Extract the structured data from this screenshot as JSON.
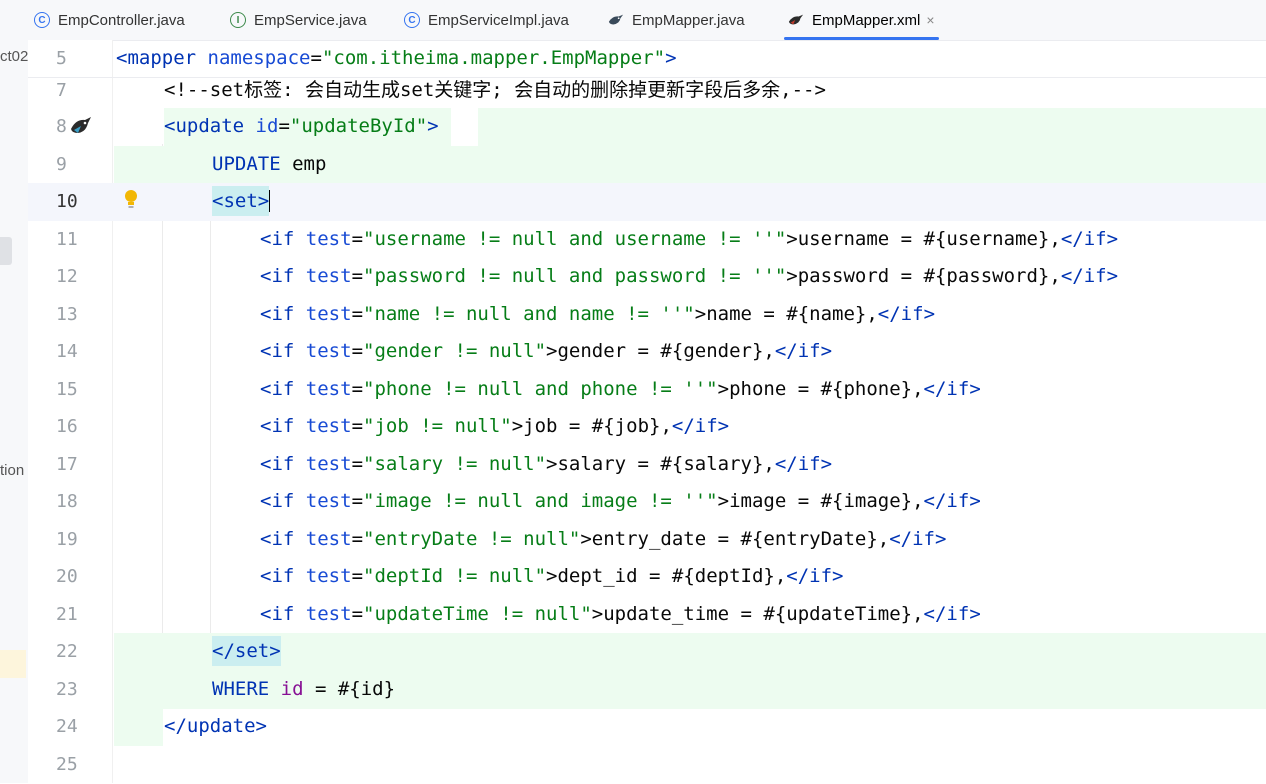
{
  "left_panel": {
    "fragment_top": "ct02",
    "fragment_mid": "tion"
  },
  "tabs": [
    {
      "label": "EmpController.java",
      "icon": "java-class-icon",
      "icon_glyph": "C"
    },
    {
      "label": "EmpService.java",
      "icon": "java-interface-icon",
      "icon_glyph": "I"
    },
    {
      "label": "EmpServiceImpl.java",
      "icon": "java-class-icon",
      "icon_glyph": "C"
    },
    {
      "label": "EmpMapper.java",
      "icon": "mybatis-bird-icon"
    },
    {
      "label": "EmpMapper.xml",
      "icon": "mybatis-bird-icon",
      "active": true,
      "close": "×"
    }
  ],
  "editor": {
    "line_numbers": [
      "5",
      "7",
      "8",
      "9",
      "10",
      "11",
      "12",
      "13",
      "14",
      "15",
      "16",
      "17",
      "18",
      "19",
      "20",
      "21",
      "22",
      "23",
      "24",
      "25"
    ],
    "current_line": "10",
    "colors": {
      "tag": "#0033b3",
      "string": "#067d17",
      "comment": "#8c8c8c",
      "added_bg": "#edfcf0",
      "tab_accent": "#3574f0"
    },
    "text": {
      "l5_open": "<",
      "l5_tag": "mapper",
      "l5_attr": "namespace",
      "l5_eq": "=",
      "l5_val": "\"com.itheima.mapper.EmpMapper\"",
      "l5_close": ">",
      "l7_comment": "<!--set标签: 会自动生成set关键字; 会自动的删除掉更新字段后多余,-->",
      "l8_open": "<",
      "l8_tag": "update",
      "l8_attr": "id",
      "l8_eq": "=",
      "l8_val": "\"updateById\"",
      "l8_close": ">",
      "l9_kw": "UPDATE",
      "l9_rest": " emp",
      "l10_set": "<set>",
      "if_open": "<",
      "if_kw": "if",
      "if_test": "test",
      "if_eq": "=",
      "if_end_open": "</",
      "if_end_close": ">",
      "r11_cond": "\"username != null and username != ''\"",
      "r11_body": ">username = #{username},",
      "r12_cond": "\"password != null and password != ''\"",
      "r12_body": ">password = #{password},",
      "r13_cond": "\"name != null and name != ''\"",
      "r13_body": ">name = #{name},",
      "r14_cond": "\"gender != null\"",
      "r14_body": ">gender = #{gender},",
      "r15_cond": "\"phone != null and phone != ''\"",
      "r15_body": ">phone = #{phone},",
      "r16_cond": "\"job != null\"",
      "r16_body": ">job = #{job},",
      "r17_cond": "\"salary != null\"",
      "r17_body": ">salary = #{salary},",
      "r18_cond": "\"image != null and image != ''\"",
      "r18_body": ">image = #{image},",
      "r19_cond": "\"entryDate != null\"",
      "r19_body": ">entry_date = #{entryDate},",
      "r20_cond": "\"deptId != null\"",
      "r20_body": ">dept_id = #{deptId},",
      "r21_cond": "\"updateTime != null\"",
      "r21_body": ">update_time = #{updateTime},",
      "l22_set_end": "</set>",
      "l23_kw": "WHERE",
      "l23_field": "id",
      "l23_rest": " = #{id}",
      "l24_open": "</",
      "l24_tag": "update",
      "l24_close": ">"
    }
  }
}
